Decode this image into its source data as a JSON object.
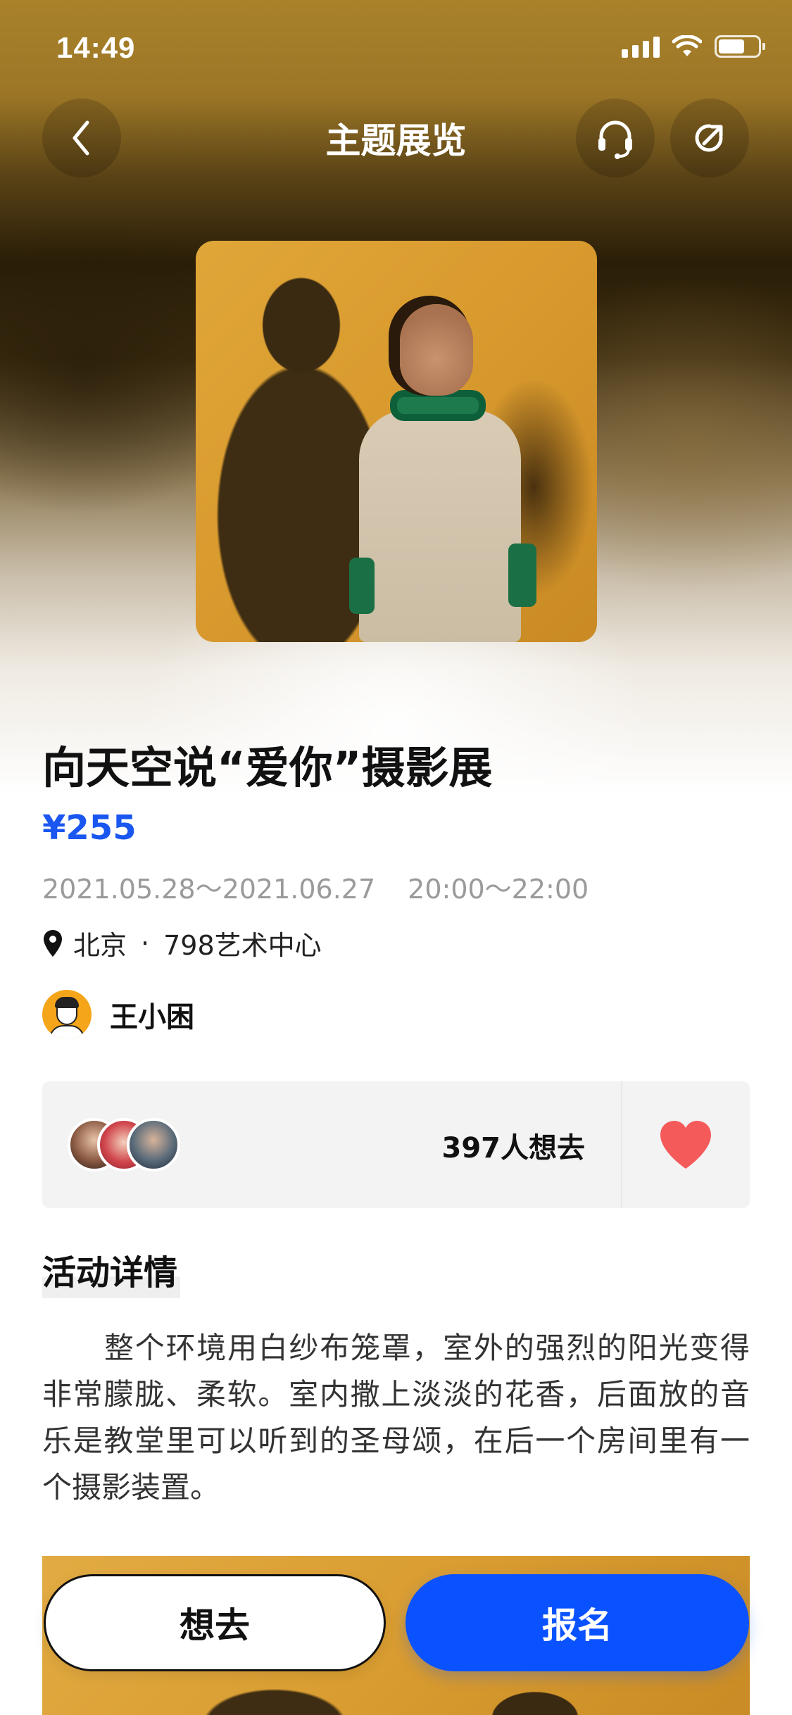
{
  "status_bar": {
    "time": "14:49"
  },
  "nav": {
    "title": "主题展览",
    "icons": [
      "back-icon",
      "headset-icon",
      "share-icon"
    ]
  },
  "event": {
    "title": "向天空说“爱你”摄影展",
    "price": "¥255",
    "date_range": "2021.05.28～2021.06.27",
    "time_range": "20:00～22:00",
    "city": "北京",
    "separator": "·",
    "venue": "798艺术中心"
  },
  "organizer": {
    "name": "王小困"
  },
  "interest": {
    "count_label": "397人想去"
  },
  "details": {
    "section_title": "活动详情",
    "description": "整个环境用白纱布笼罩，室外的强烈的阳光变得非常朦胧、柔软。室内撒上淡淡的花香，后面放的音乐是教堂里可以听到的圣母颂，在后一个房间里有一个摄影装置。"
  },
  "actions": {
    "want_label": "想去",
    "signup_label": "报名"
  },
  "colors": {
    "accent_blue": "#0a52ff",
    "price_blue": "#1a56f0",
    "heart_red": "#f45a5a"
  }
}
